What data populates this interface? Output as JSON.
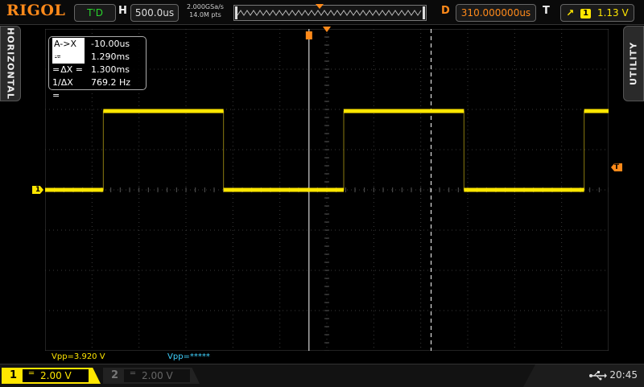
{
  "topbar": {
    "brand": "RIGOL",
    "run_state": "T'D",
    "h_label": "H",
    "timebase": "500.0us",
    "sample_rate": "2.000GSa/s",
    "mem_depth": "14.0M pts",
    "d_label": "D",
    "delay": "310.000000us",
    "t_label": "T",
    "trigger_edge_icon": "rising-edge-icon",
    "trigger_channel": "1",
    "trigger_level": "1.13 V"
  },
  "side_tabs": {
    "left": "HORIZONTAL",
    "right": "UTILITY"
  },
  "cursors": {
    "rows": [
      {
        "label": "A->X =",
        "value": "-10.00us"
      },
      {
        "label": "B->X =",
        "value": "1.290ms"
      },
      {
        "label": "ΔX =",
        "value": "1.300ms"
      },
      {
        "label": "1/ΔX =",
        "value": "769.2 Hz"
      }
    ]
  },
  "markers": {
    "ch1": "1",
    "trigger_level": "T"
  },
  "measurements": {
    "vpp_ch1": "Vpp=3.920 V",
    "vpp_ch2": "Vpp=*****"
  },
  "bottombar": {
    "ch1": {
      "number": "1",
      "coupling": "═",
      "scale": "2.00 V"
    },
    "ch2": {
      "number": "2",
      "coupling": "═",
      "scale": "2.00 V"
    },
    "time": "20:45"
  },
  "colors": {
    "ch1": "#ffe600",
    "trigger": "#ff8a1a",
    "ch2": "#3fd2ff",
    "run": "#29d22c"
  },
  "trace": {
    "waveform": "square",
    "high_v": 3.92,
    "low_v": 0,
    "volts_per_div": 2.0,
    "time_per_div_us": 500,
    "transitions_div": [
      1.24,
      3.8,
      6.36,
      8.92
    ]
  }
}
